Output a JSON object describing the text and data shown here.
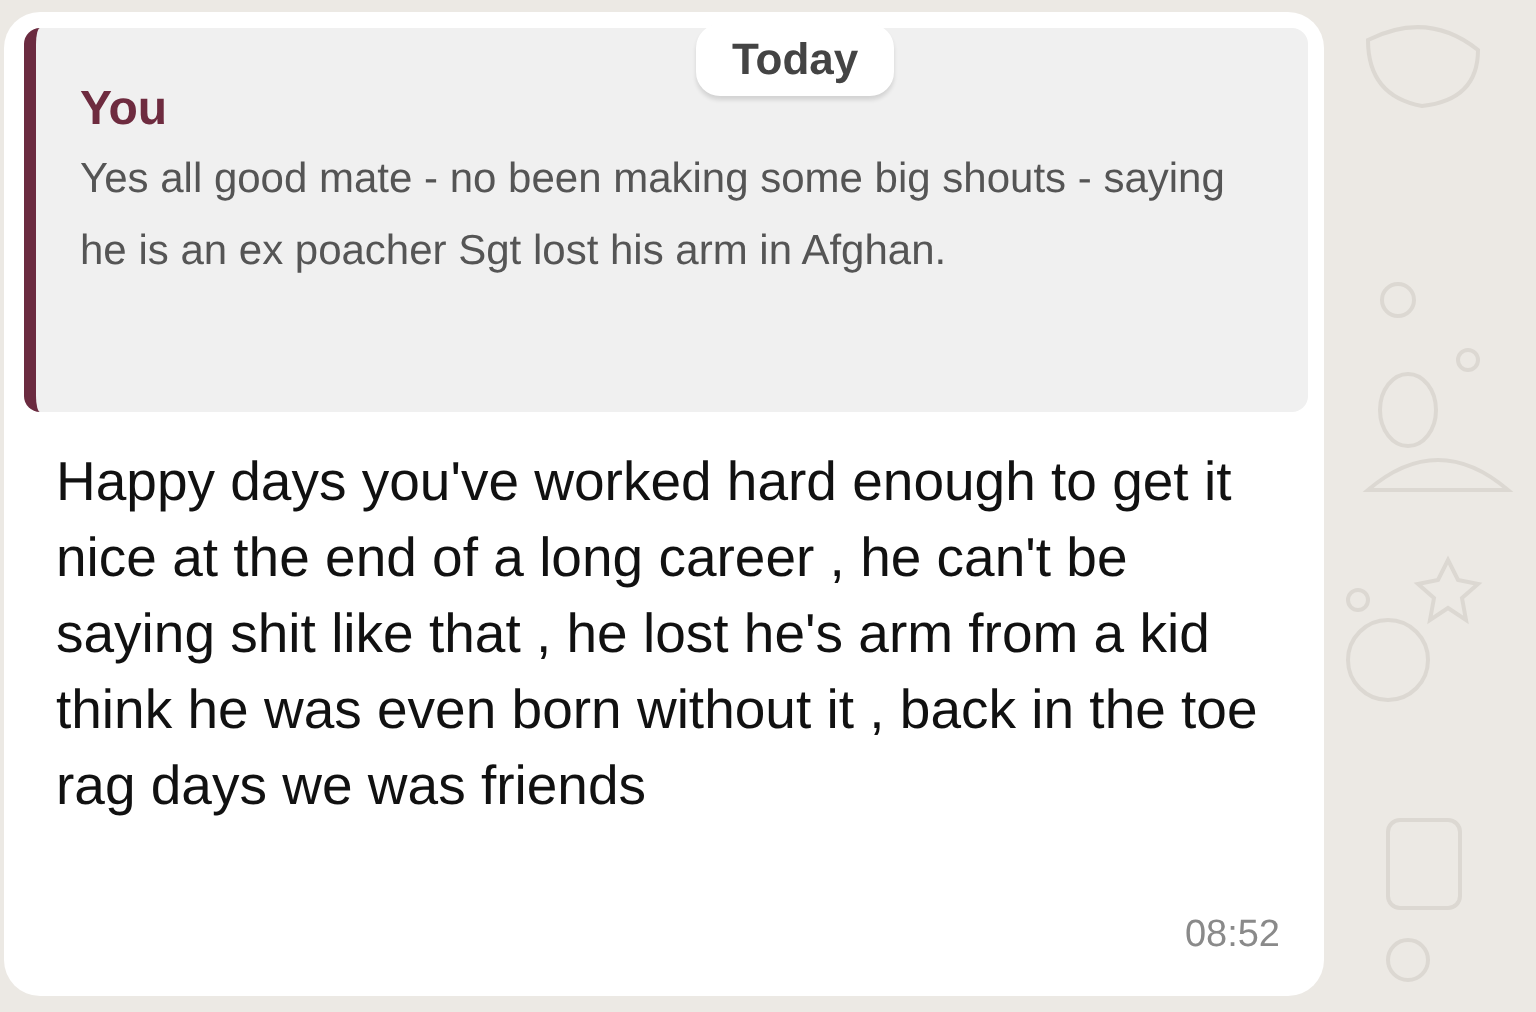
{
  "date_chip": "Today",
  "quoted_message": {
    "author": "You",
    "text": "Yes all good mate - no been making some big shouts - saying he is an ex poacher Sgt lost his arm in Afghan."
  },
  "message": {
    "text": "Happy days you've worked hard enough to get it nice at the end of a long career , he can't be saying shit like that , he lost he's arm from a kid think he was even born without it , back in the toe rag days we was friends",
    "time": "08:52"
  }
}
